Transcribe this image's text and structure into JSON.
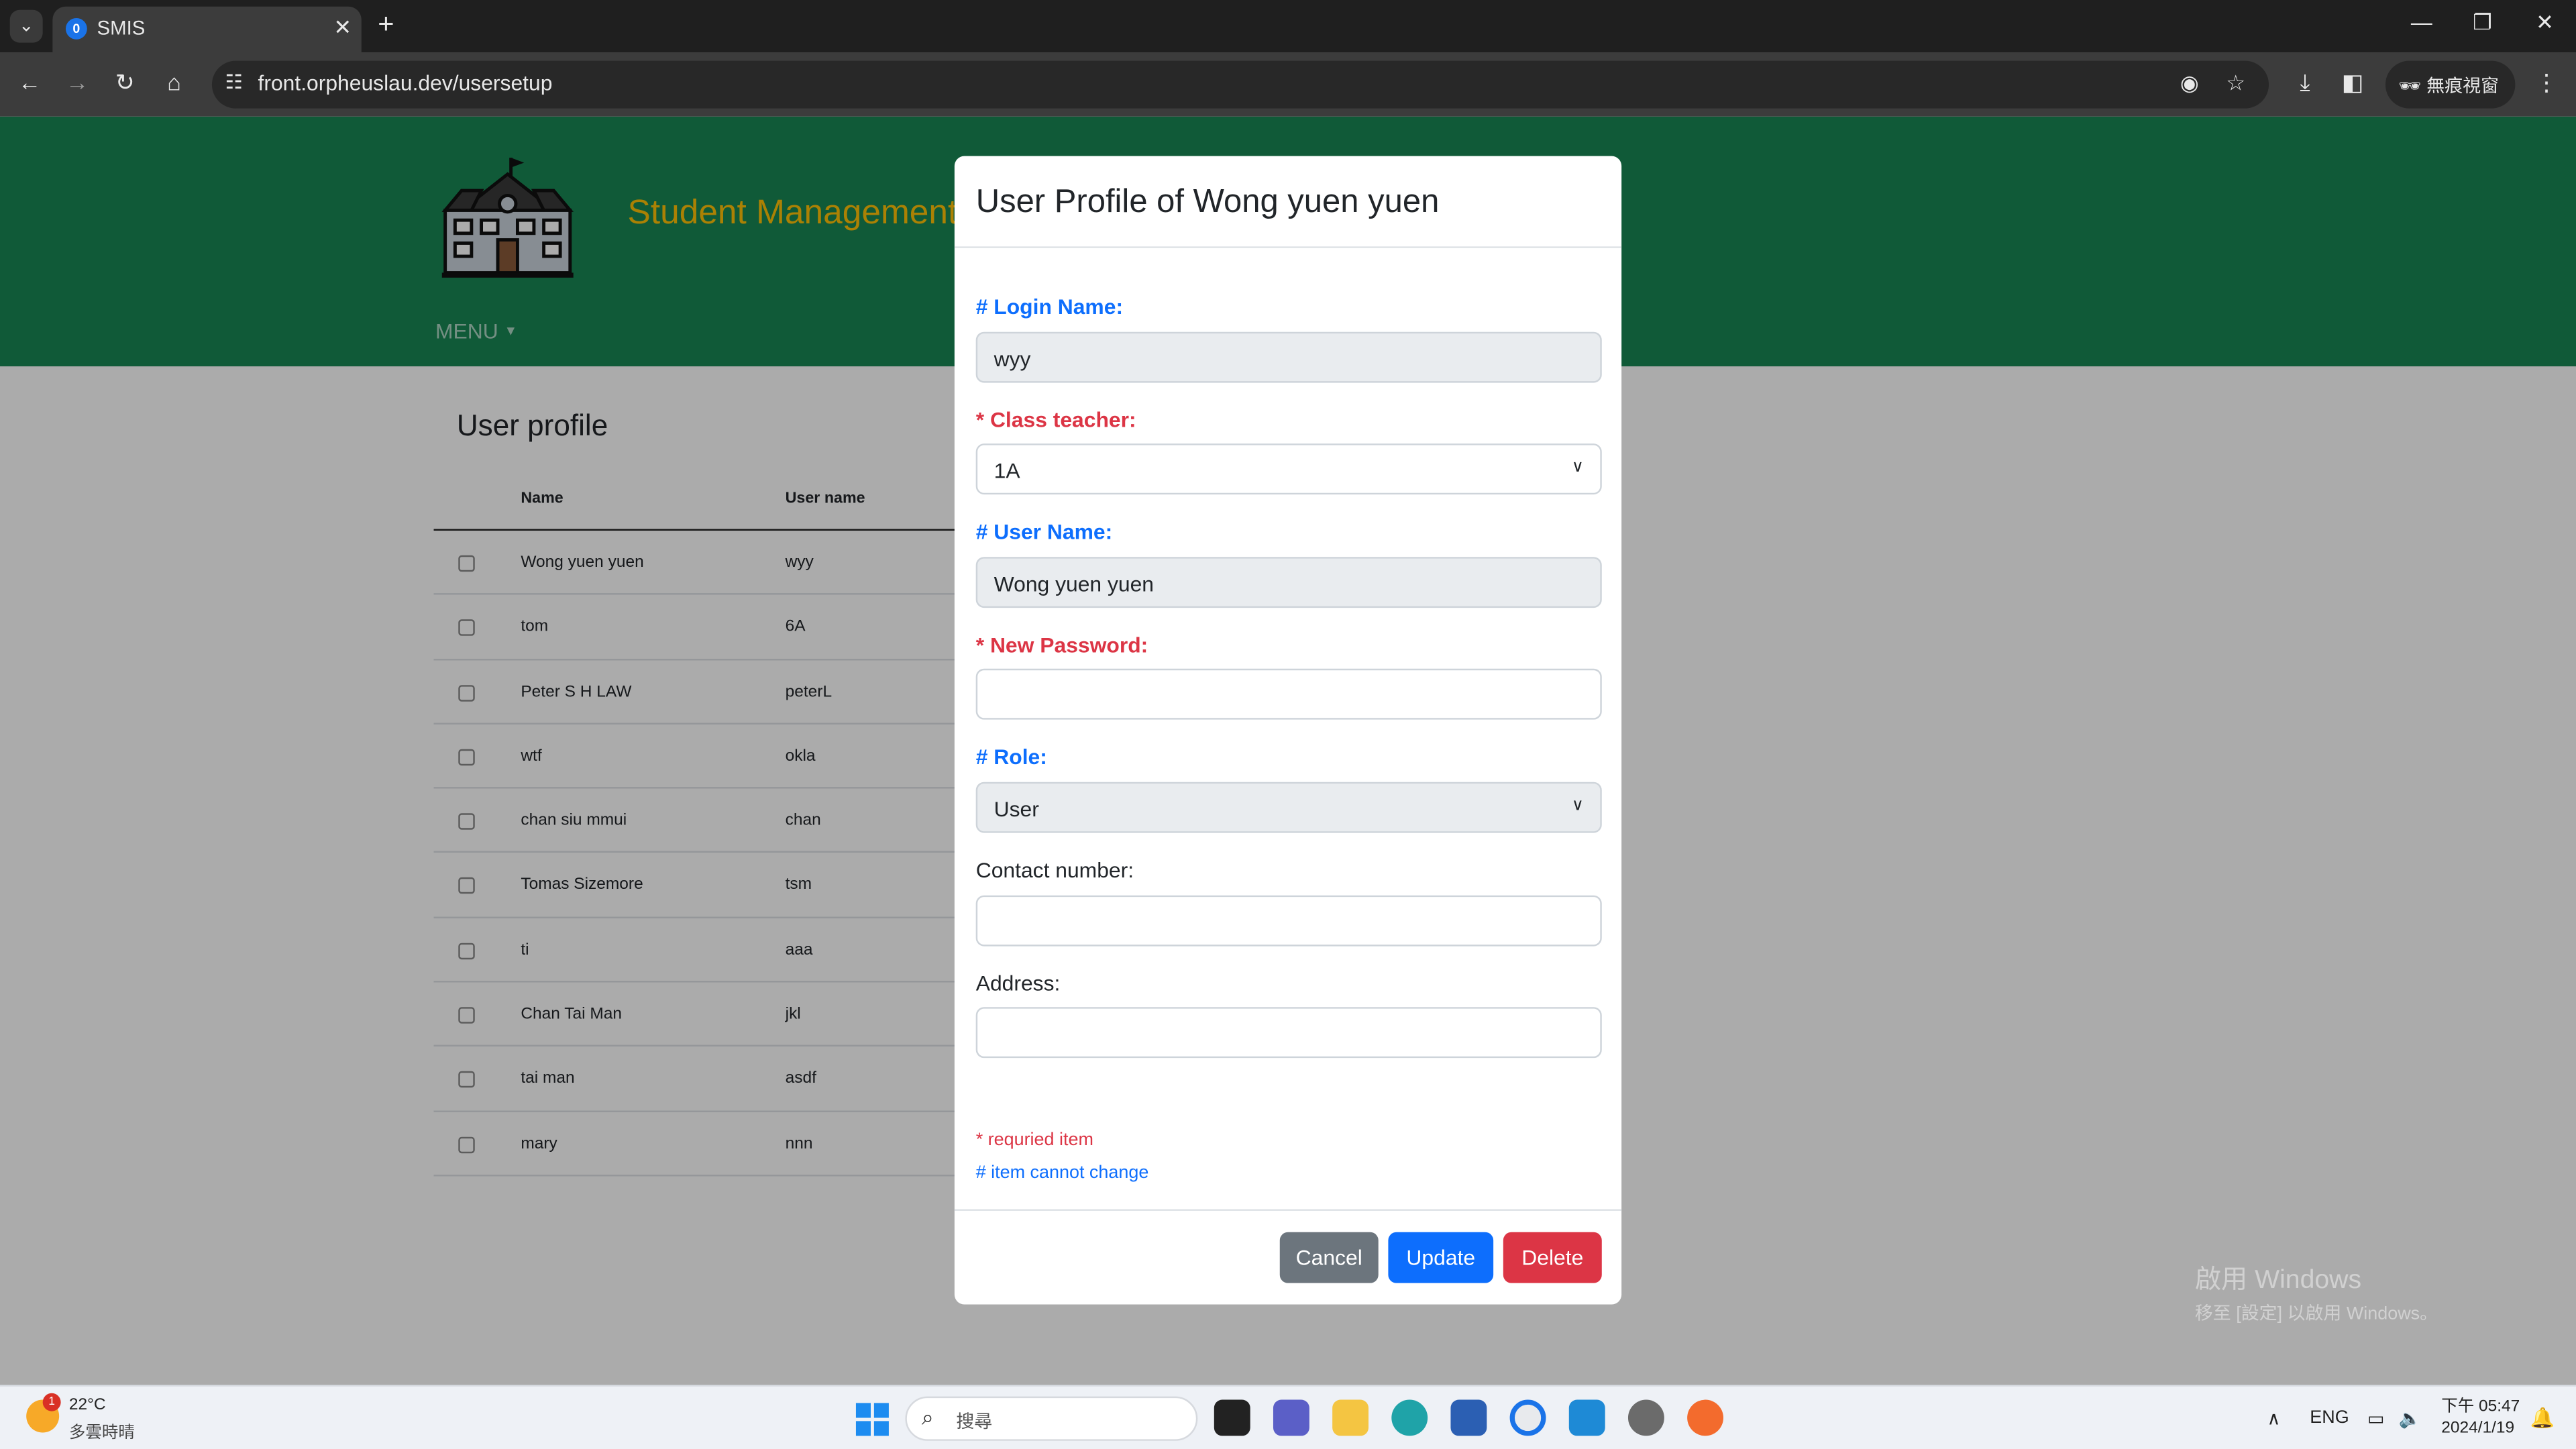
{
  "browser": {
    "tab_title": "SMIS",
    "tab_favicon": "0",
    "url": "front.orpheuslau.dev/usersetup",
    "incognito_label": "無痕視窗"
  },
  "header": {
    "brand": "Student Management",
    "menu_label": "MENU"
  },
  "content": {
    "title": "User profile",
    "columns": [
      "Name",
      "User name"
    ],
    "rows": [
      {
        "name": "Wong yuen yuen",
        "username": "wyy"
      },
      {
        "name": "tom",
        "username": "6A"
      },
      {
        "name": "Peter S H LAW",
        "username": "peterL"
      },
      {
        "name": "wtf",
        "username": "okla"
      },
      {
        "name": "chan siu mmui",
        "username": "chan"
      },
      {
        "name": "Tomas Sizemore",
        "username": "tsm"
      },
      {
        "name": "ti",
        "username": "aaa"
      },
      {
        "name": "Chan Tai Man",
        "username": "jkl"
      },
      {
        "name": "tai man",
        "username": "asdf"
      },
      {
        "name": "mary",
        "username": "nnn"
      }
    ]
  },
  "modal": {
    "title": "User Profile of Wong yuen yuen",
    "login_name_label": "# Login Name:",
    "login_name_value": "wyy",
    "class_teacher_label": "* Class teacher:",
    "class_teacher_value": "1A",
    "user_name_label": "# User Name:",
    "user_name_value": "Wong yuen yuen",
    "new_password_label": "* New Password:",
    "new_password_value": "",
    "role_label": "# Role:",
    "role_value": "User",
    "contact_label": "Contact number:",
    "contact_value": "",
    "address_label": "Address:",
    "address_value": "",
    "note_required": "* requried item",
    "note_nochange": "# item cannot change",
    "cancel_label": "Cancel",
    "update_label": "Update",
    "delete_label": "Delete"
  },
  "watermark": {
    "line1": "啟用 Windows",
    "line2": "移至 [設定] 以啟用 Windows。"
  },
  "taskbar": {
    "weather_temp": "22°C",
    "weather_desc": "多雲時晴",
    "weather_badge": "1",
    "search_placeholder": "搜尋",
    "lang": "ENG",
    "time": "下午 05:47",
    "date": "2024/1/19"
  },
  "colors": {
    "header_bg": "#198754",
    "brand": "#ffc107",
    "required": "#dc3545",
    "no_change": "#0d6efd",
    "cancel": "#6c757d",
    "update": "#0d6efd",
    "delete": "#dc3545"
  }
}
